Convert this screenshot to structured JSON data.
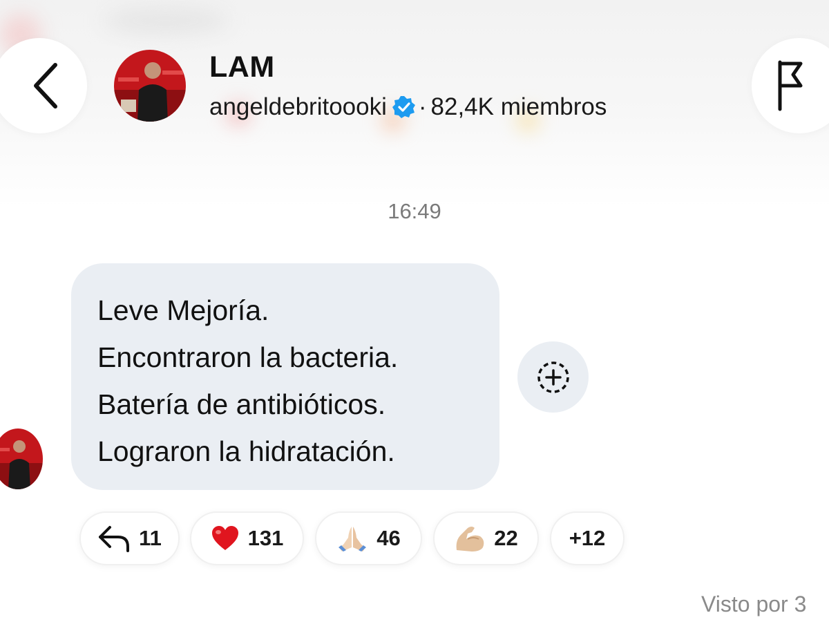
{
  "header": {
    "channel_name": "LAM",
    "channel_handle": "angeldebritoooki",
    "separator": "·",
    "member_count": "82,4K miembros",
    "icons": {
      "back": "back-chevron-icon",
      "verified": "verified-badge-icon",
      "flag": "flag-icon"
    }
  },
  "conversation": {
    "timestamp": "16:49",
    "message": {
      "lines": [
        "Leve Mejoría.",
        "Encontraron la bacteria.",
        "Batería de antibióticos.",
        "Lograron la hidratación."
      ]
    },
    "add_reaction_icon": "add-reaction-icon",
    "reactions": [
      {
        "icon": "reply-arrow-icon",
        "count": "11"
      },
      {
        "icon": "red-heart-icon",
        "count": "131"
      },
      {
        "icon": "folded-hands-icon",
        "count": "46"
      },
      {
        "icon": "flexed-biceps-icon",
        "count": "22"
      }
    ],
    "more_reactions": "+12",
    "seen_by": "Visto por 3"
  },
  "colors": {
    "bubble_bg": "#eaeef3",
    "verified_blue": "#1d9bf0",
    "heart_red": "#e0151f",
    "muted_text": "#7a7a7a"
  }
}
